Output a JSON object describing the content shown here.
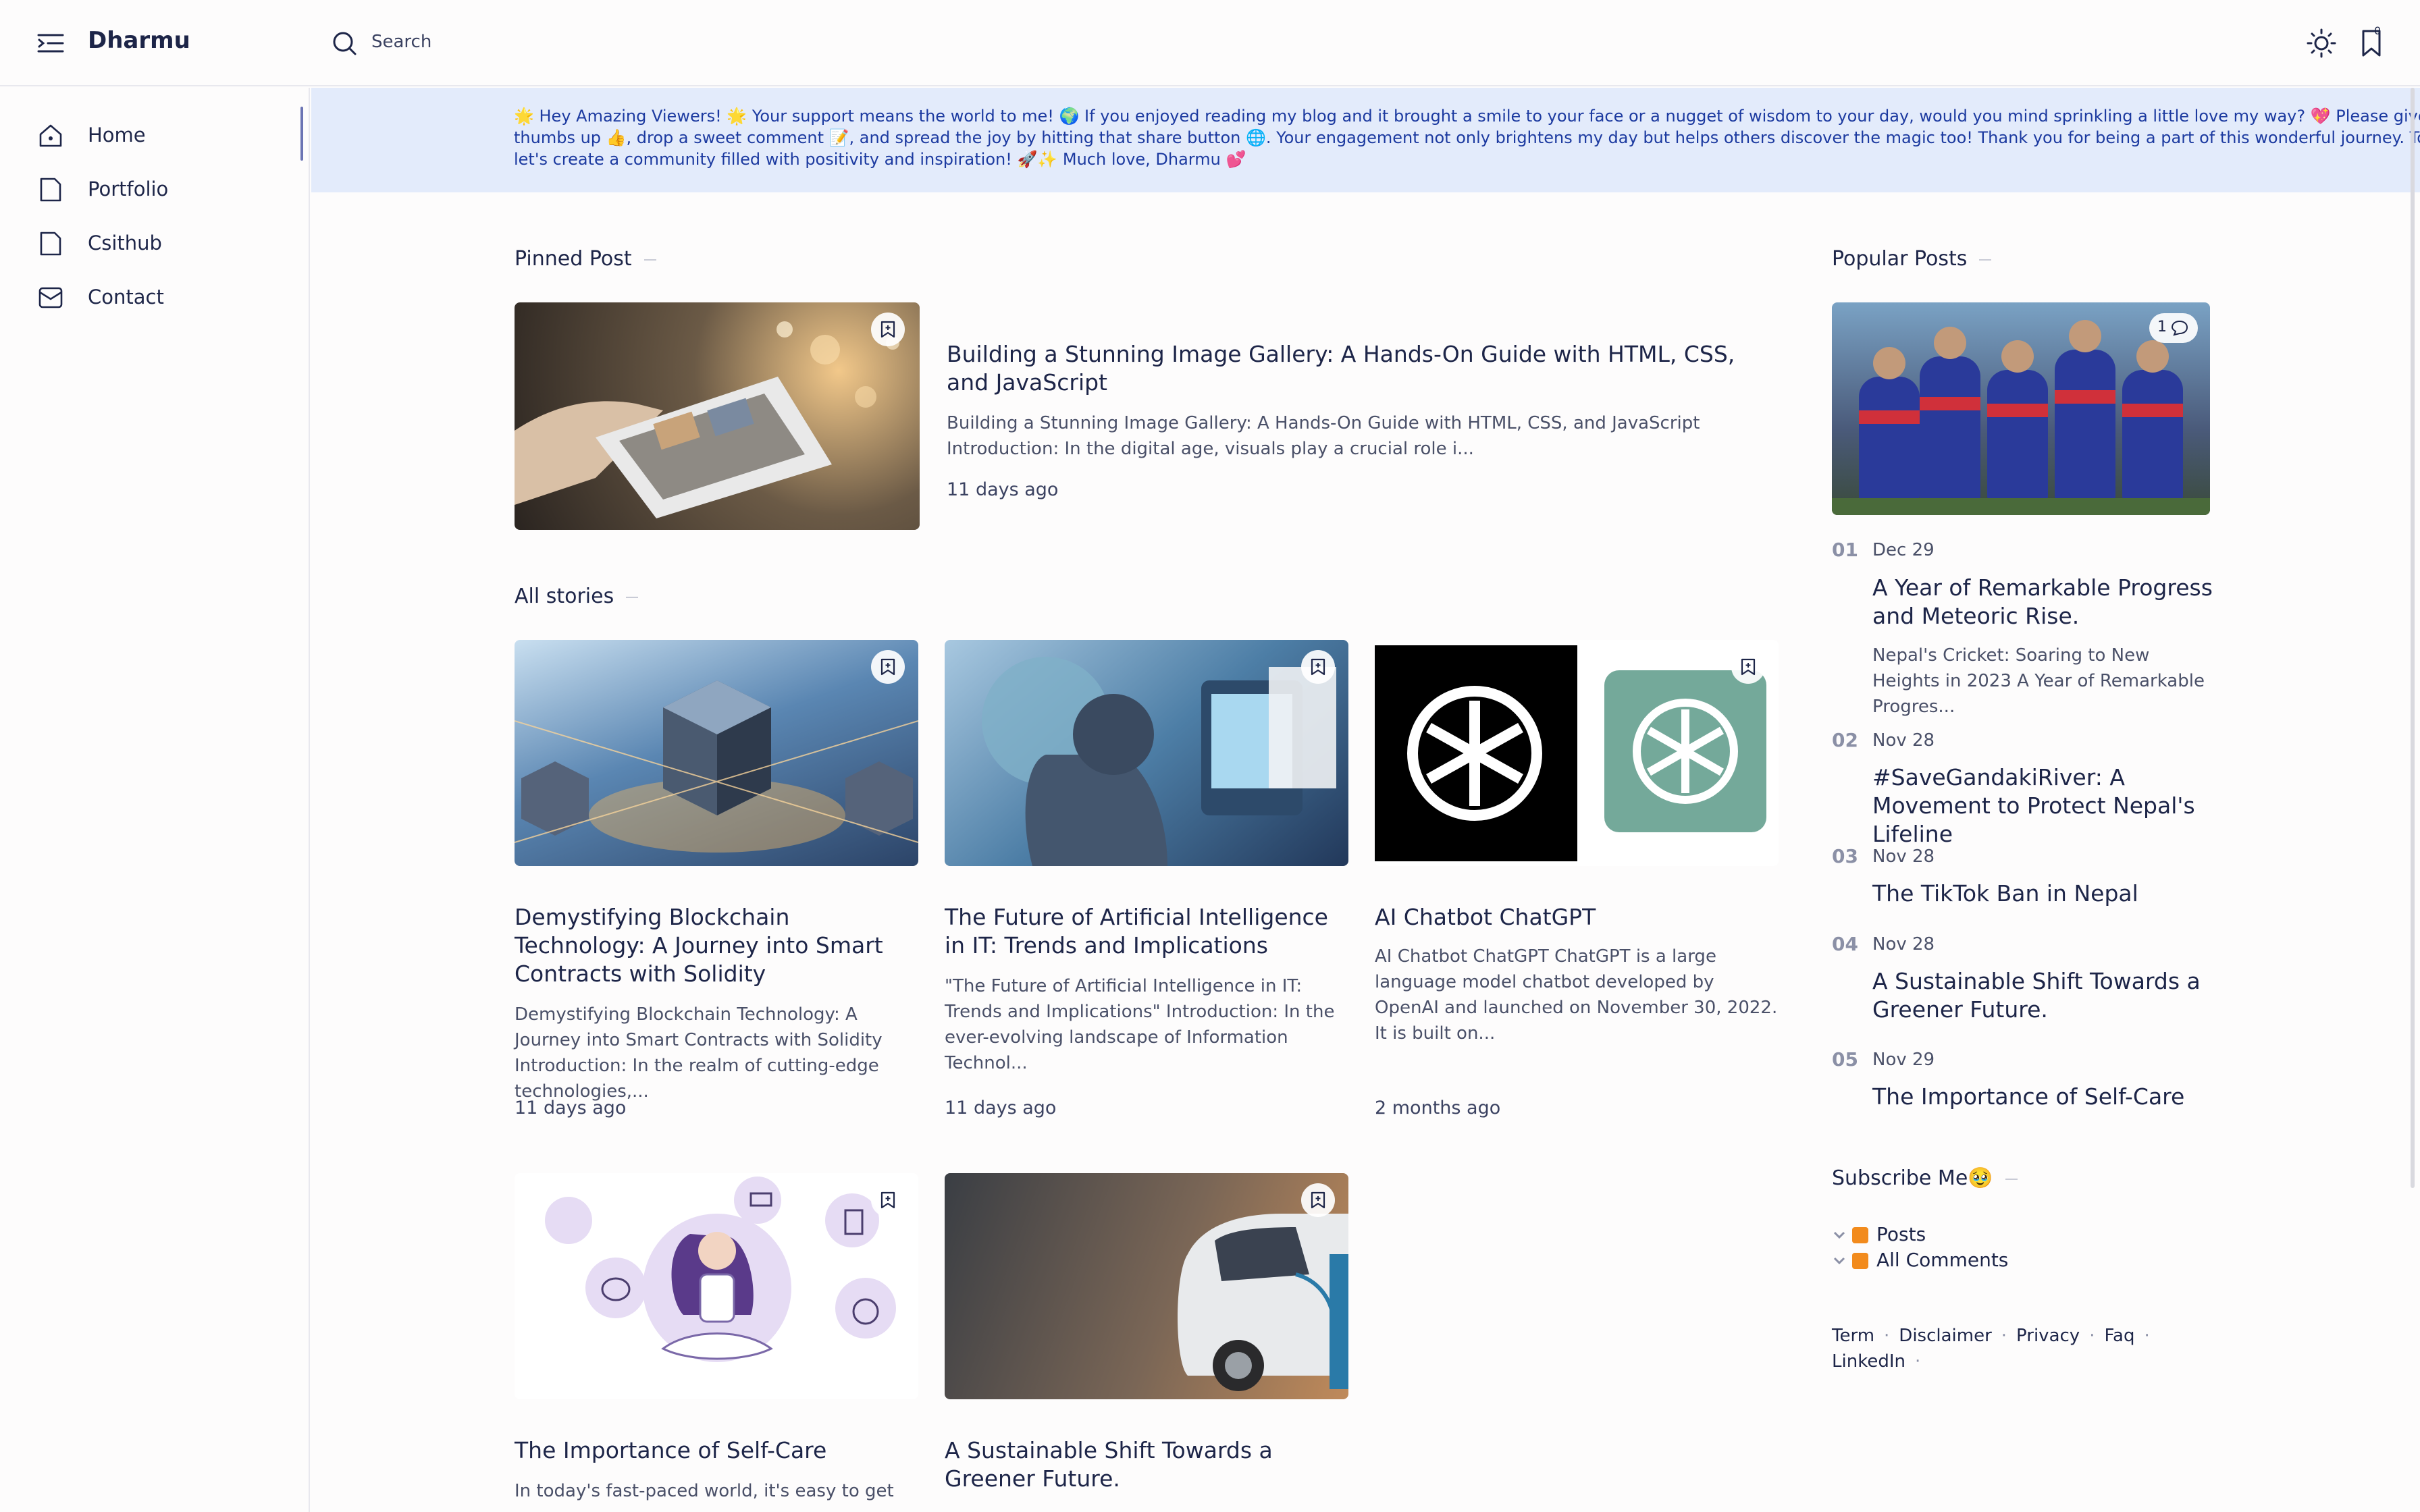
{
  "header": {
    "brand": "Dharmu",
    "search_label": "Search",
    "bookmark_count": "0"
  },
  "sidebar": {
    "items": [
      {
        "label": "Home"
      },
      {
        "label": "Portfolio"
      },
      {
        "label": "Csithub"
      },
      {
        "label": "Contact"
      }
    ]
  },
  "notice": {
    "text": "🌟 Hey Amazing Viewers! 🌟 Your support means the world to me! 🌍 If you enjoyed reading my blog and it brought a smile to your face or a nugget of wisdom to your day, would you mind sprinkling a little love my way? 💖 Please give it a thumbs up 👍, drop a sweet comment 📝, and spread the joy by hitting that share button 🌐. Your engagement not only brightens my day but helps others discover the magic too! Thank you for being a part of this wonderful journey. Together, let's create a community filled with positivity and inspiration! 🚀✨ Much love, Dharmu 💕"
  },
  "pinned": {
    "section_title": "Pinned Post",
    "title": "Building a Stunning Image Gallery: A Hands-On Guide with HTML, CSS, and JavaScript",
    "excerpt": "Building a Stunning Image Gallery: A Hands-On Guide with HTML, CSS, and JavaScript Introduction: In the digital age, visuals play a crucial role i...",
    "date": "11 days ago"
  },
  "stories": {
    "section_title": "All stories",
    "items": [
      {
        "title": "Demystifying Blockchain Technology: A Journey into Smart Contracts with Solidity",
        "excerpt": "Demystifying Blockchain Technology: A Journey into Smart Contracts with Solidity Introduction: In the realm of cutting-edge technologies,...",
        "date": "11 days ago"
      },
      {
        "title": "The Future of Artificial Intelligence in IT: Trends and Implications",
        "excerpt": "\"The Future of Artificial Intelligence in IT: Trends and Implications\" Introduction: In the ever-evolving landscape of Information Technol...",
        "date": "11 days ago"
      },
      {
        "title": "AI Chatbot ChatGPT",
        "excerpt": "AI Chatbot ChatGPT ChatGPT is a large language model chatbot developed by OpenAI and launched on November 30, 2022. It is built on...",
        "date": "2 months ago"
      },
      {
        "title": "The Importance of Self-Care",
        "excerpt": "In today's fast-paced world, it's easy to get",
        "date": ""
      },
      {
        "title": "A Sustainable Shift Towards a Greener Future.",
        "excerpt": "",
        "date": ""
      }
    ]
  },
  "popular": {
    "section_title": "Popular Posts",
    "comment_count": "1",
    "items": [
      {
        "num": "01",
        "date": "Dec 29",
        "title": "A Year of Remarkable Progress and Meteoric Rise.",
        "excerpt": "Nepal's Cricket: Soaring to New Heights in 2023   A Year of Remarkable Progres..."
      },
      {
        "num": "02",
        "date": "Nov 28",
        "title": "#SaveGandakiRiver: A Movement to Protect Nepal's Lifeline"
      },
      {
        "num": "03",
        "date": "Nov 28",
        "title": "The TikTok Ban in Nepal"
      },
      {
        "num": "04",
        "date": "Nov 28",
        "title": "A Sustainable Shift Towards a Greener Future."
      },
      {
        "num": "05",
        "date": "Nov 29",
        "title": "The Importance of Self-Care"
      }
    ]
  },
  "subscribe": {
    "section_title": "Subscribe Me🥹",
    "feeds": [
      {
        "label": "Posts"
      },
      {
        "label": "All Comments"
      }
    ]
  },
  "footer": {
    "links": [
      "Term",
      "Disclaimer",
      "Privacy",
      "Faq",
      "LinkedIn"
    ]
  },
  "colors": {
    "accent": "#1c3aa0",
    "notice_bg": "#e3ebfb",
    "text": "#1d2548",
    "rss": "#f28b1d"
  }
}
